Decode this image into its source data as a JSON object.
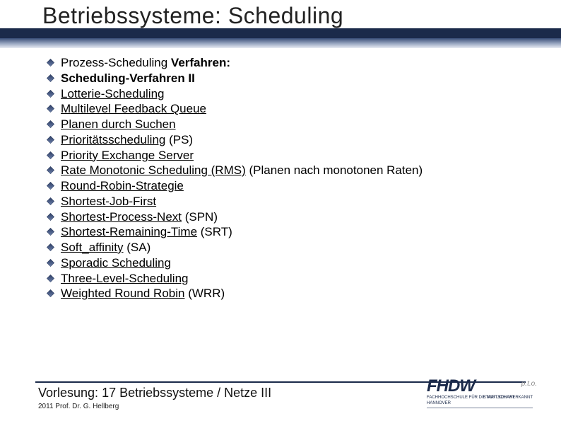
{
  "title": "Betriebssysteme: Scheduling",
  "items": [
    {
      "pre": "Prozess-Scheduling ",
      "bold": "Verfahren:",
      "post": ""
    },
    {
      "bold": "Scheduling-Verfahren II"
    },
    {
      "link": "Lotterie-Scheduling"
    },
    {
      "link": "Multilevel Feedback Queue"
    },
    {
      "link": "Planen durch Suchen"
    },
    {
      "link": "Prioritätsscheduling",
      "post": " (PS)"
    },
    {
      "link": "Priority Exchange Server"
    },
    {
      "link": "Rate Monotonic Scheduling (RMS)",
      "post": " (Planen nach monotonen Raten)"
    },
    {
      "link": "Round-Robin-Strategie"
    },
    {
      "link": "Shortest-Job-First"
    },
    {
      "link": "Shortest-Process-Next",
      "post": " (SPN)"
    },
    {
      "link": "Shortest-Remaining-Time",
      "post": " (SRT)"
    },
    {
      "link": "Soft_affinity",
      "post": " (SA)"
    },
    {
      "link": "Sporadic Scheduling"
    },
    {
      "link": "Three-Level-Scheduling"
    },
    {
      "link": "Weighted Round Robin",
      "post": " (WRR)"
    }
  ],
  "footer": {
    "label": "Vorlesung:",
    "text": " 17 Betriebssysteme / Netze III",
    "sub": "2011 Prof. Dr. G. Hellberg"
  },
  "logo": {
    "main": "FHDW",
    "small": "p.t.o.",
    "sub1": "FACHHOCHSCHULE FÜR DIE WIRTSCHAFT",
    "sub2": "HANNOVER",
    "sub3": "STAATLICH ANERKANNT"
  }
}
